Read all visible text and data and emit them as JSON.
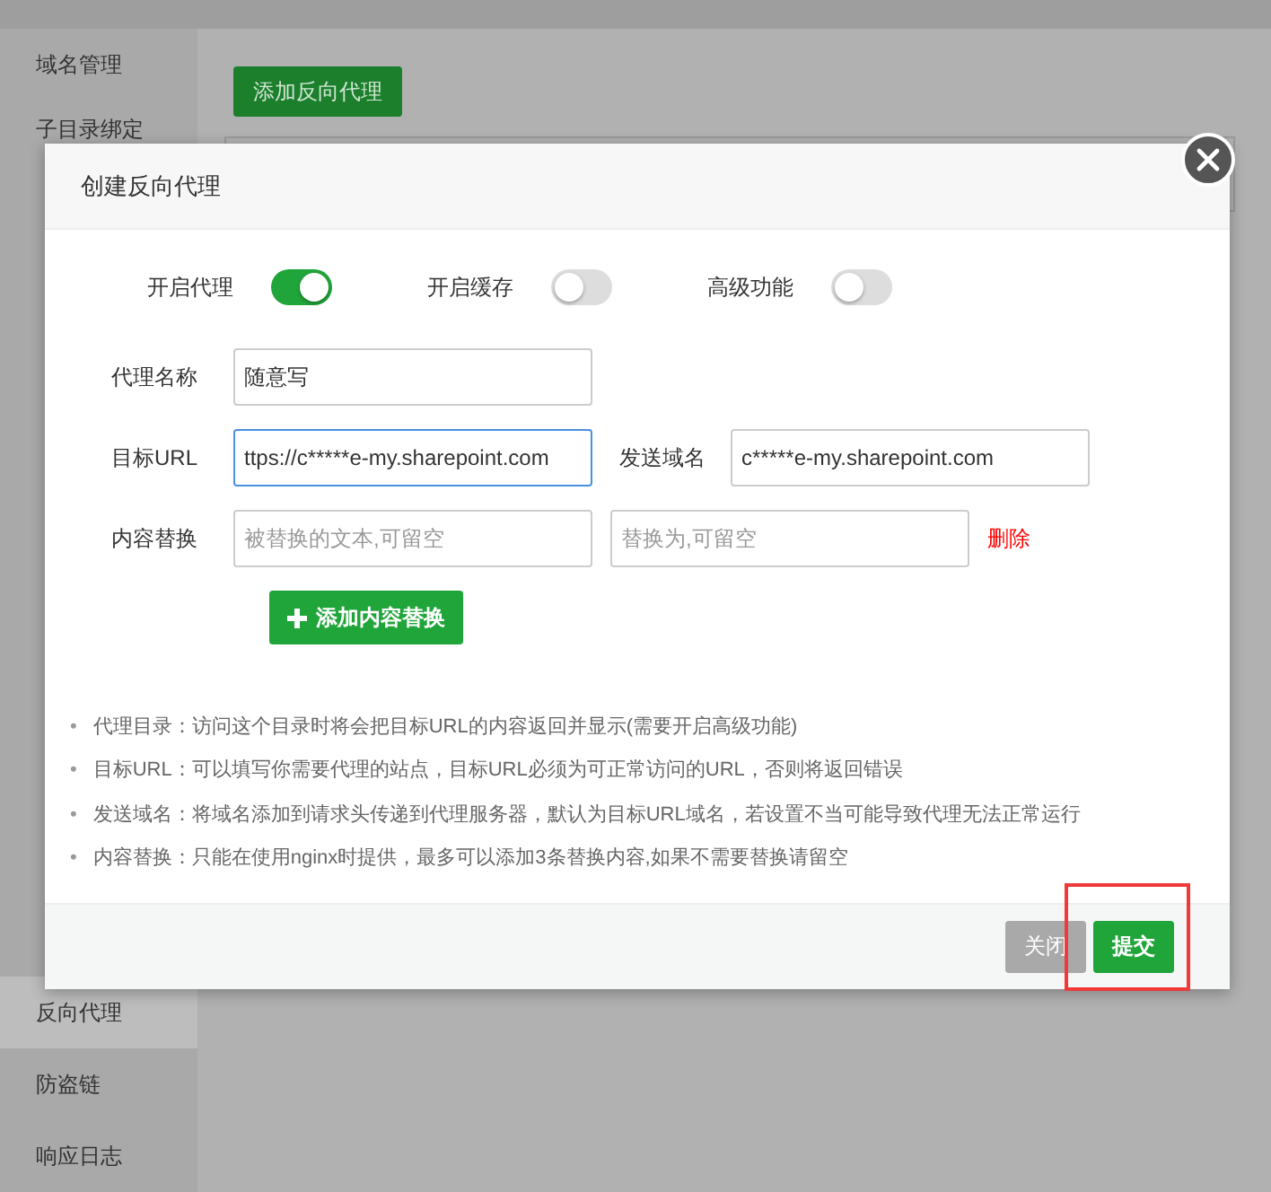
{
  "sidebar": {
    "top_items": [
      {
        "label": "域名管理",
        "selected": false
      },
      {
        "label": "子目录绑定",
        "selected": false
      }
    ],
    "bottom_items": [
      {
        "label": "反向代理",
        "selected": true
      },
      {
        "label": "防盗链",
        "selected": false
      },
      {
        "label": "响应日志",
        "selected": false
      }
    ]
  },
  "toolbar": {
    "add_button": "添加反向代理"
  },
  "dialog": {
    "title": "创建反向代理",
    "switches": [
      {
        "label": "开启代理",
        "on": true
      },
      {
        "label": "开启缓存",
        "on": false
      },
      {
        "label": "高级功能",
        "on": false
      }
    ],
    "name_field": {
      "label": "代理名称",
      "value": "随意写",
      "focused": false
    },
    "target_field": {
      "label": "目标URL",
      "value": "ttps://c*****e-my.sharepoint.com",
      "focused": true
    },
    "host_field": {
      "label": "发送域名",
      "value": "c*****e-my.sharepoint.com",
      "focused": false
    },
    "replace_row": {
      "label": "内容替换",
      "from_placeholder": "被替换的文本,可留空",
      "to_placeholder": "替换为,可留空",
      "delete_link": "删除"
    },
    "add_replace_button": "添加内容替换",
    "notes": [
      {
        "bullet": "•",
        "text": "代理目录：访问这个目录时将会把目标URL的内容返回并显示(需要开启高级功能)"
      },
      {
        "bullet": "•",
        "text": "目标URL：可以填写你需要代理的站点，目标URL必须为可正常访问的URL，否则将返回错误"
      },
      {
        "bullet": "•",
        "text": "发送域名：将域名添加到请求头传递到代理服务器，默认为目标URL域名，若设置不当可能导致代理无法正常运行"
      },
      {
        "bullet": "•",
        "text": "内容替换：只能在使用nginx时提供，最多可以添加3条替换内容,如果不需要替换请留空"
      }
    ],
    "buttons": [
      {
        "label": "关闭",
        "kind": "secondary"
      },
      {
        "label": "提交",
        "kind": "primary"
      }
    ]
  }
}
